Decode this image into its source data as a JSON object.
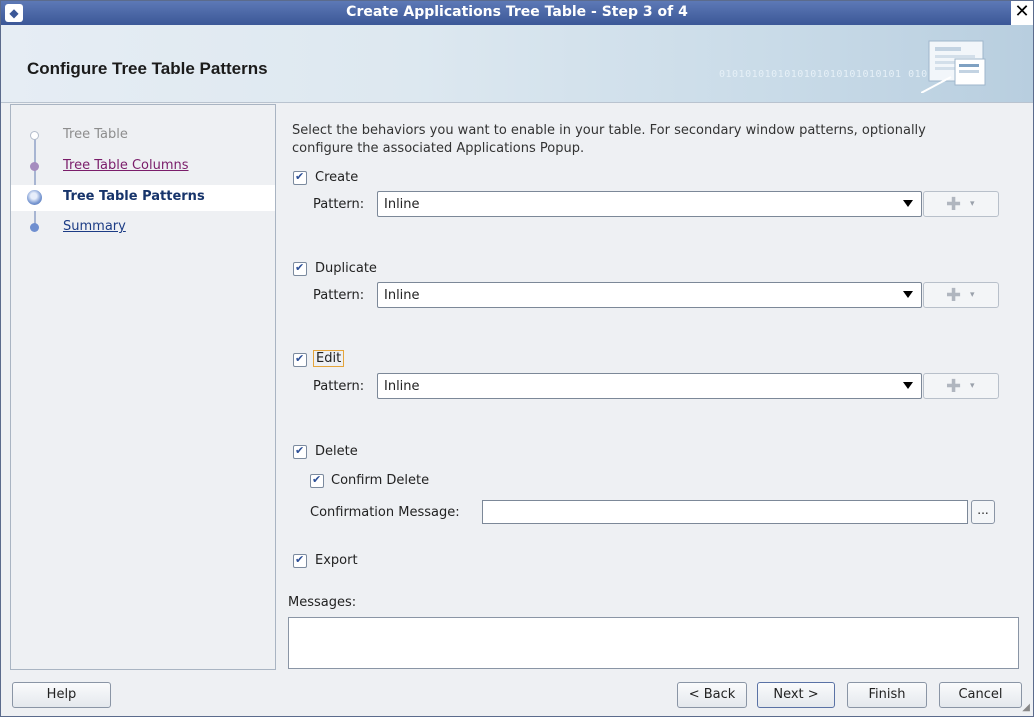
{
  "window": {
    "title": "Create Applications Tree Table - Step 3 of 4",
    "close_glyph": "✕"
  },
  "header": {
    "title": "Configure Tree Table Patterns",
    "binary_text": "0101010101010101010101010101 01010101010"
  },
  "nav": {
    "steps": [
      {
        "label": "Tree Table",
        "state": "visited"
      },
      {
        "label": "Tree Table Columns",
        "state": "done"
      },
      {
        "label": "Tree Table Patterns",
        "state": "current"
      },
      {
        "label": "Summary",
        "state": "future"
      }
    ]
  },
  "main": {
    "intro": "Select the behaviors you want to enable in your table.  For secondary window patterns, optionally configure the associated Applications Popup.",
    "create": {
      "label": "Create",
      "checked": true,
      "pattern_label": "Pattern:",
      "pattern_value": "Inline"
    },
    "duplicate": {
      "label": "Duplicate",
      "checked": true,
      "pattern_label": "Pattern:",
      "pattern_value": "Inline"
    },
    "edit": {
      "label": "Edit",
      "checked": true,
      "pattern_label": "Pattern:",
      "pattern_value": "Inline"
    },
    "delete": {
      "label": "Delete",
      "checked": true
    },
    "confirm_delete": {
      "label": "Confirm Delete",
      "checked": true
    },
    "confirmation_message": {
      "label": "Confirmation Message:",
      "value": "",
      "browse_label": "..."
    },
    "export": {
      "label": "Export",
      "checked": true
    },
    "messages": {
      "label": "Messages:",
      "value": ""
    }
  },
  "footer": {
    "help": "Help",
    "back": "< Back",
    "next": "Next >",
    "finish": "Finish",
    "cancel": "Cancel"
  },
  "colors": {
    "titlebar": "#3b5797",
    "nav_current": "#17346b",
    "nav_link": "#1c3c85",
    "nav_visited_link": "#7a1d6a"
  }
}
